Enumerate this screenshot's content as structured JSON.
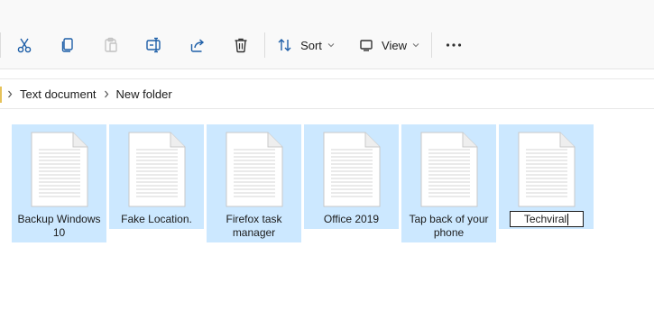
{
  "toolbar": {
    "items": [
      {
        "name": "cut-button",
        "icon": "scissors-icon"
      },
      {
        "name": "copy-button",
        "icon": "copy-icon"
      },
      {
        "name": "paste-button",
        "icon": "paste-icon",
        "disabled": true
      },
      {
        "name": "rename-button",
        "icon": "rename-icon"
      },
      {
        "name": "share-button",
        "icon": "share-icon"
      },
      {
        "name": "delete-button",
        "icon": "trash-icon"
      }
    ],
    "sort_label": "Sort",
    "view_label": "View",
    "more_icon": "more-horizontal-icon"
  },
  "address": {
    "crumbs": [
      "Text document",
      "New folder"
    ]
  },
  "files": [
    {
      "name": "Backup Windows 10",
      "line1": "Backup Windows",
      "line2": "10",
      "selected": true
    },
    {
      "name": "Fake Location.",
      "line1": "Fake Location.",
      "line2": "",
      "selected": true
    },
    {
      "name": "Firefox task manager",
      "line1": "Firefox task",
      "line2": "manager",
      "selected": true
    },
    {
      "name": "Office 2019",
      "line1": "Office 2019",
      "line2": "",
      "selected": true
    },
    {
      "name": "Tap back of your phone",
      "line1": "Tap back of your",
      "line2": "phone",
      "selected": true
    },
    {
      "name": "Techviral",
      "rename_value": "Techviral",
      "selected": true,
      "renaming": true
    }
  ],
  "colors": {
    "selection": "#cce8ff",
    "toolbar_bg": "#f9f9f9",
    "icon": "#1e5fa8"
  }
}
